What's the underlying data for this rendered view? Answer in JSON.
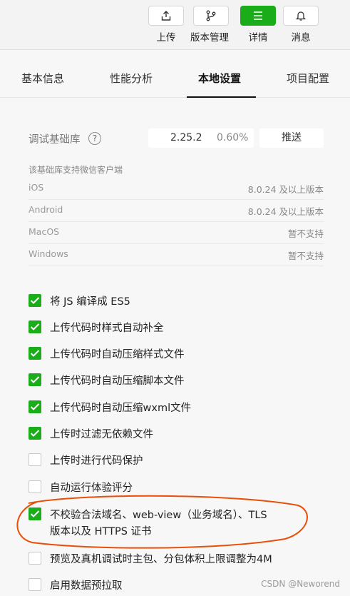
{
  "toolbar": {
    "upload": {
      "label": "上传",
      "icon": "upload-icon"
    },
    "version": {
      "label": "版本管理",
      "icon": "branch-icon"
    },
    "details": {
      "label": "详情",
      "icon": "menu-icon"
    },
    "messages": {
      "label": "消息",
      "icon": "bell-icon"
    },
    "accent": "#1aad19"
  },
  "tabs": [
    {
      "label": "基本信息"
    },
    {
      "label": "性能分析"
    },
    {
      "label": "本地设置",
      "active": true
    },
    {
      "label": "项目配置"
    }
  ],
  "debug_library": {
    "label": "调试基础库",
    "help": "?",
    "version": "2.25.2",
    "percent": "0.60%",
    "push_label": "推送",
    "support_title": "该基础库支持微信客户端",
    "clients": [
      {
        "name": "iOS",
        "value": "8.0.24 及以上版本"
      },
      {
        "name": "Android",
        "value": "8.0.24 及以上版本"
      },
      {
        "name": "MacOS",
        "value": "暂不支持"
      },
      {
        "name": "Windows",
        "value": "暂不支持"
      }
    ]
  },
  "options": [
    {
      "label": "将 JS 编译成 ES5",
      "checked": true
    },
    {
      "label": "上传代码时样式自动补全",
      "checked": true
    },
    {
      "label": "上传代码时自动压缩样式文件",
      "checked": true
    },
    {
      "label": "上传代码时自动压缩脚本文件",
      "checked": true
    },
    {
      "label": "上传代码时自动压缩wxml文件",
      "checked": true
    },
    {
      "label": "上传时过滤无依赖文件",
      "checked": true
    },
    {
      "label": "上传时进行代码保护",
      "checked": false
    },
    {
      "label": "自动运行体验评分",
      "checked": false
    },
    {
      "label": "不校验合法域名、web-view（业务域名）、TLS",
      "label2": "版本以及 HTTPS 证书",
      "checked": true
    },
    {
      "label": "预览及真机调试时主包、分包体积上限调整为4M",
      "checked": false
    },
    {
      "label": "启用数据预拉取",
      "checked": false
    }
  ],
  "watermark": "CSDN @Neworend",
  "highlight_color": "#e8500a"
}
